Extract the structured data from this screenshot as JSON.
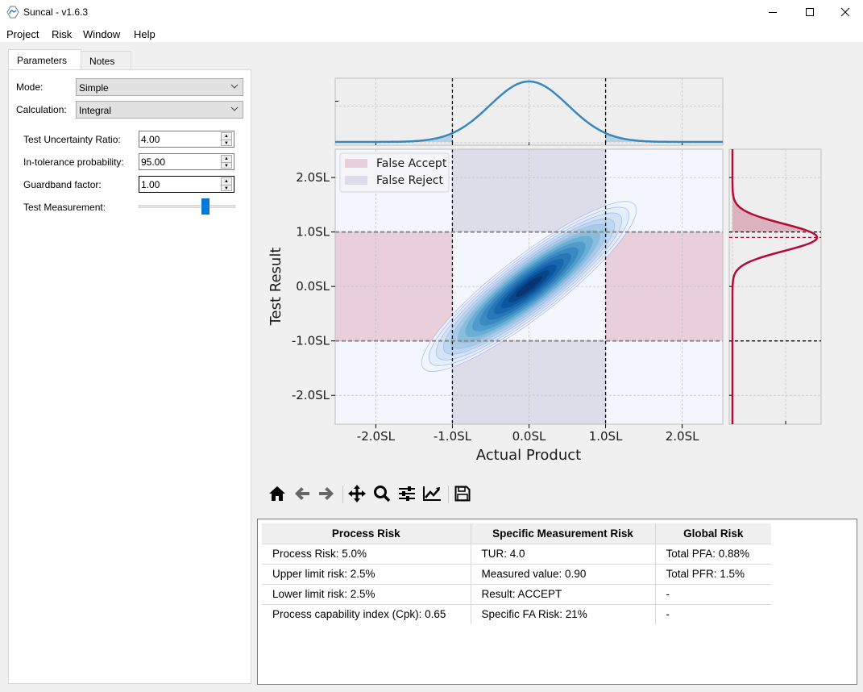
{
  "window": {
    "title": "Suncal - v1.6.3",
    "controls": [
      "minimize",
      "maximize",
      "close"
    ]
  },
  "menu": [
    "Project",
    "Risk",
    "Window",
    "Help"
  ],
  "tabs": [
    {
      "label": "Parameters",
      "active": true
    },
    {
      "label": "Notes",
      "active": false
    }
  ],
  "parameters": {
    "mode_label": "Mode:",
    "mode_value": "Simple",
    "calculation_label": "Calculation:",
    "calculation_value": "Integral",
    "tur_label": "Test Uncertainty Ratio:",
    "tur_value": "4.00",
    "itp_label": "In-tolerance probability:",
    "itp_value": "95.00",
    "gbf_label": "Guardband factor:",
    "gbf_value": "1.00",
    "test_measurement_label": "Test Measurement:",
    "test_measurement_fraction": 0.7
  },
  "chart_data": {
    "type": "heatmap",
    "xlabel": "Actual Product",
    "ylabel": "Test Result",
    "x_ticks": [
      "-2.0SL",
      "-1.0SL",
      "0.0SL",
      "1.0SL",
      "2.0SL"
    ],
    "x_tick_values": [
      -2,
      -1,
      0,
      1,
      2
    ],
    "y_ticks": [
      "2.0SL",
      "1.0SL",
      "0.0SL",
      "-1.0SL",
      "-2.0SL"
    ],
    "y_tick_values": [
      2,
      1,
      0,
      -1,
      -2
    ],
    "xlim": [
      -2.53,
      2.53
    ],
    "ylim": [
      -2.53,
      2.52
    ],
    "spec_limits": [
      -1,
      1
    ],
    "acceptance_limits": [
      -1,
      1
    ],
    "grid": true,
    "legend": {
      "placement": "top-left",
      "entries": [
        {
          "label": "False Accept",
          "color": "#e8cfd9"
        },
        {
          "label": "False Reject",
          "color": "#dcdde9"
        }
      ]
    },
    "joint_distribution": {
      "product_mean": 0.0,
      "product_sd": 0.51,
      "measurement_sd": 0.25,
      "colormap": "Blues"
    },
    "top_marginal": {
      "label": "Product distribution",
      "mean": 0.0,
      "sd": 0.51,
      "color": "#3a87bd"
    },
    "right_marginal": {
      "label": "Test measurement distribution",
      "measured_value": 0.9,
      "sd": 0.25,
      "color": "#b30c36"
    },
    "colors": {
      "false_accept": "#e8cfd9",
      "false_reject": "#dcdde9",
      "background": "#f3f7fd",
      "marginal_bg": "#eeeeee"
    }
  },
  "toolbar": [
    "home",
    "back",
    "forward",
    "pan",
    "zoom",
    "configure-subplots",
    "edit-axis",
    "save"
  ],
  "results": {
    "headers": [
      "Process Risk",
      "Specific Measurement Risk",
      "Global Risk"
    ],
    "rows": [
      [
        "Process Risk: 5.0%",
        "TUR: 4.0",
        "Total PFA: 0.88%"
      ],
      [
        "Upper limit risk: 2.5%",
        "Measured value: 0.90",
        "Total PFR: 1.5%"
      ],
      [
        "Lower limit risk: 2.5%",
        "Result: ACCEPT",
        "-"
      ],
      [
        "Process capability index (Cpk): 0.65",
        "Specific FA Risk: 21%",
        "-"
      ]
    ]
  }
}
